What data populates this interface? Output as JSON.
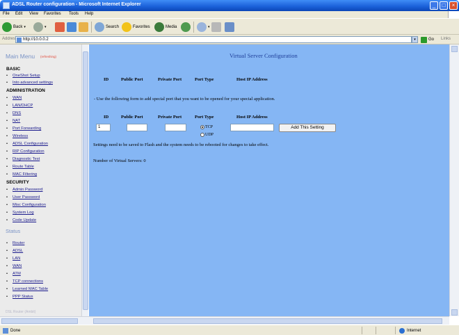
{
  "window": {
    "title": "ADSL Router configuration - Microsoft Internet Explorer"
  },
  "menubar": [
    "File",
    "Edit",
    "View",
    "Favorites",
    "Tools",
    "Help"
  ],
  "toolbar": {
    "back": "Back",
    "search": "Search",
    "favorites": "Favorites",
    "media": "Media"
  },
  "address": {
    "label": "Address",
    "value": "http://10.0.0.2",
    "go": "Go",
    "links": "Links"
  },
  "sidebar": {
    "title": "Main Menu",
    "title_note": "(refreshing)",
    "basic": {
      "heading": "BASIC",
      "items": [
        "OneShot Setup",
        "Into advanced settings"
      ]
    },
    "administration": {
      "heading": "ADMINISTRATION",
      "items": [
        "WAN",
        "LAN/DHCP",
        "DNS",
        "NAT",
        "Port Forwarding",
        "Wireless",
        "ADSL Configuration",
        "RIP Configuration",
        "Diagnostic Test",
        "Route Table",
        "MAC Filtering"
      ]
    },
    "security": {
      "heading": "SECURITY",
      "items": [
        "Admin Password",
        "User Password",
        "Misc Configuration",
        "System Log",
        "Code Update"
      ]
    },
    "status": {
      "heading": "Status",
      "items": [
        "Router",
        "ADSL",
        "LAN",
        "WAN",
        "ATM",
        "TCP connections",
        "Learned MAC Table",
        "PPP Status"
      ]
    },
    "bottom_text": "DSL Router (Ambit)"
  },
  "content": {
    "title": "Virtual Server Configuration",
    "table_headers": [
      "ID",
      "Public Port",
      "Private Port",
      "Port Type",
      "Host IP Address"
    ],
    "note": "- Use the following form to add special port that you want to be opened for your special application.",
    "form_headers": [
      "ID",
      "Public Port",
      "Private Port",
      "Port Type",
      "Host IP Address"
    ],
    "form": {
      "id_value": "1",
      "public_port": "",
      "private_port": "",
      "host_ip": "",
      "tcp_label": "TCP",
      "udp_label": "UDP",
      "selected": "TCP"
    },
    "add_button": "Add This Setting",
    "save_note": "Settings need to be saved to Flash and the system needs to be rebooted for changes to take effect.",
    "count_text": "Number of Virtual Servers: 0"
  },
  "statusbar": {
    "left": "Done",
    "right": "Internet"
  },
  "colors": {
    "content_bg": "#85b6f4",
    "sidebar_bg": "#ebebeb",
    "title_blue": "#1f3f9a"
  }
}
